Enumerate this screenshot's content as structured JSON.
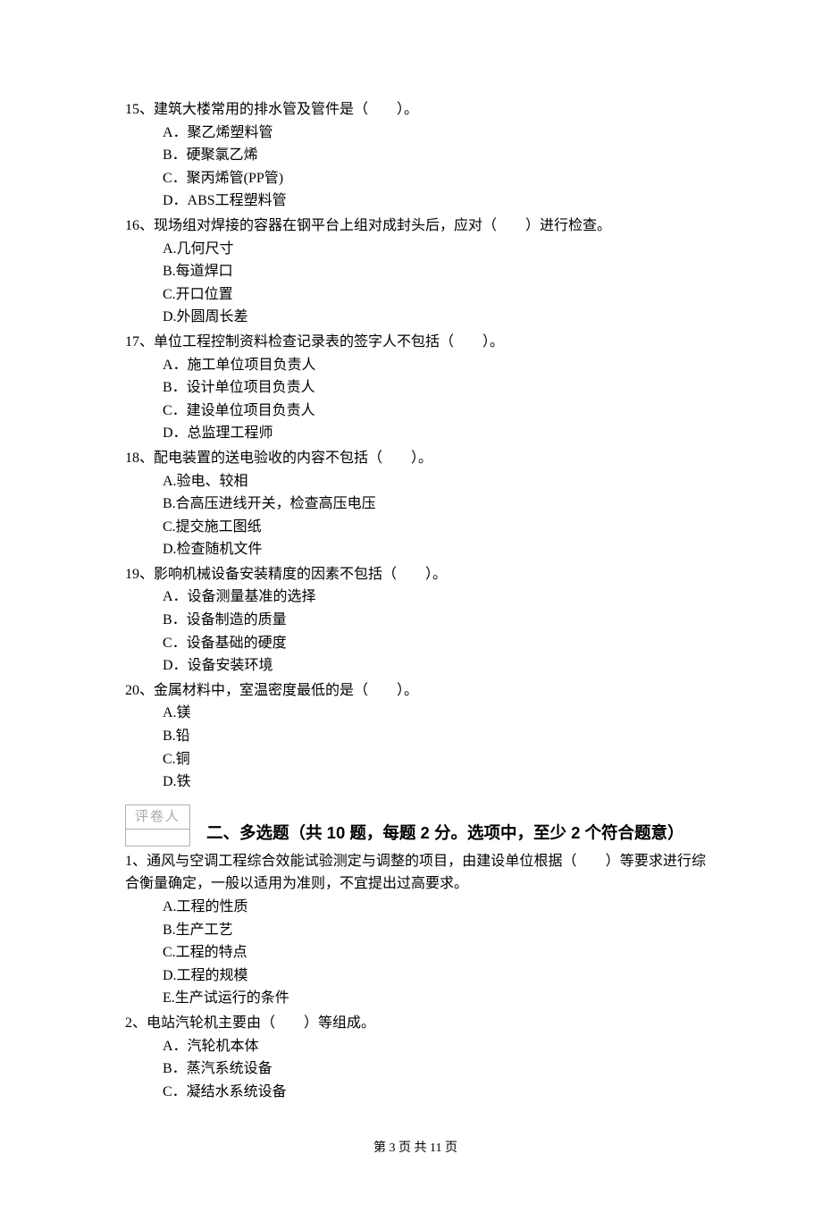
{
  "questions_single": [
    {
      "num": "15、",
      "text": "建筑大楼常用的排水管及管件是（　　）。",
      "options": [
        "A．聚乙烯塑料管",
        "B．硬聚氯乙烯",
        "C．聚丙烯管(PP管)",
        "D．ABS工程塑料管"
      ]
    },
    {
      "num": "16、",
      "text": "现场组对焊接的容器在钢平台上组对成封头后，应对（　　）进行检查。",
      "options": [
        "A.几何尺寸",
        "B.每道焊口",
        "C.开口位置",
        "D.外圆周长差"
      ]
    },
    {
      "num": "17、",
      "text": "单位工程控制资料检查记录表的签字人不包括（　　）。",
      "options": [
        "A．施工单位项目负责人",
        "B．设计单位项目负责人",
        "C．建设单位项目负责人",
        "D．总监理工程师"
      ]
    },
    {
      "num": "18、",
      "text": "配电装置的送电验收的内容不包括（　　）。",
      "options": [
        "A.验电、较相",
        "B.合高压进线开关，检查高压电压",
        "C.提交施工图纸",
        "D.检查随机文件"
      ]
    },
    {
      "num": "19、",
      "text": "影响机械设备安装精度的因素不包括（　　）。",
      "options": [
        "A．设备测量基准的选择",
        "B．设备制造的质量",
        "C．设备基础的硬度",
        "D．设备安装环境"
      ]
    },
    {
      "num": "20、",
      "text": "金属材料中，室温密度最低的是（　　）。",
      "options": [
        "A.镁",
        "B.铅",
        "C.铜",
        "D.铁"
      ]
    }
  ],
  "grader_label": "评卷人",
  "section2_title": "二、多选题（共 10 题，每题 2 分。选项中，至少 2 个符合题意）",
  "questions_multi": [
    {
      "num": "1、",
      "text": "通风与空调工程综合效能试验测定与调整的项目，由建设单位根据（　　）等要求进行综合衡量确定，一般以适用为准则，不宜提出过高要求。",
      "options": [
        "A.工程的性质",
        "B.生产工艺",
        "C.工程的特点",
        "D.工程的规模",
        "E.生产试运行的条件"
      ]
    },
    {
      "num": "2、",
      "text": "电站汽轮机主要由（　　）等组成。",
      "options": [
        "A．汽轮机本体",
        "B．蒸汽系统设备",
        "C．凝结水系统设备"
      ]
    }
  ],
  "footer": "第 3 页 共 11 页"
}
